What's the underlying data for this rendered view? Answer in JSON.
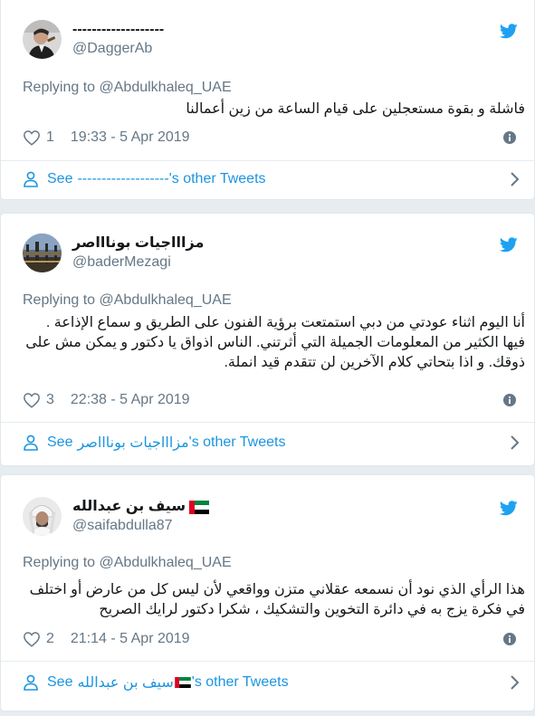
{
  "tweets": [
    {
      "display_name": "-------------------",
      "handle": "@DaggerAb",
      "replying_label": "Replying to",
      "replying_to": "@Abdulkhaleq_UAE",
      "text": "فاشلة و بقوة مستعجلين على قيام الساعة من زين أعمالنا",
      "likes": "1",
      "timestamp": "19:33 - 5 Apr 2019",
      "see_label": "See",
      "see_name": "-------------------",
      "other_tweets_label": "'s other Tweets"
    },
    {
      "display_name": "مزاااجيات بوناااصر",
      "handle": "@baderMezagi",
      "replying_label": "Replying to",
      "replying_to": "@Abdulkhaleq_UAE",
      "text": "أنا اليوم اثناء عودتي من دبي استمتعت برؤية الفنون على الطريق و سماع الإذاعة . فيها الكثير من المعلومات الجميلة التي أثرتني. الناس اذواق يا دكتور و يمكن مش على ذوقك. و اذا بتحاتي كلام الآخرين لن تتقدم قيد انملة.",
      "likes": "3",
      "timestamp": "22:38 - 5 Apr 2019",
      "see_label": "See",
      "see_name": "مزاااجيات بوناااصر",
      "other_tweets_label": "'s other Tweets"
    },
    {
      "display_name": "سيف بن عبدالله",
      "handle": "@saifabdulla87",
      "replying_label": "Replying to",
      "replying_to": "@Abdulkhaleq_UAE",
      "text": "هذا الرأي الذي نود أن نسمعه عقلاني متزن وواقعي لأن ليس كل من عارض أو اختلف في فكرة يزج به في دائرة التخوين والتشكيك ، شكرا دكتور لرايك الصريح",
      "likes": "2",
      "timestamp": "21:14 - 5 Apr 2019",
      "see_label": "See",
      "see_name": "سيف بن عبدالله",
      "other_tweets_label": "'s other Tweets"
    }
  ],
  "colors": {
    "link_blue": "#1b95e0",
    "twitter_blue": "#1da1f2",
    "muted": "#657786",
    "background": "#e6ecf0"
  },
  "icons": [
    "twitter-bird-icon",
    "heart-icon",
    "info-icon",
    "user-icon",
    "chevron-right-icon",
    "uae-flag-icon"
  ]
}
